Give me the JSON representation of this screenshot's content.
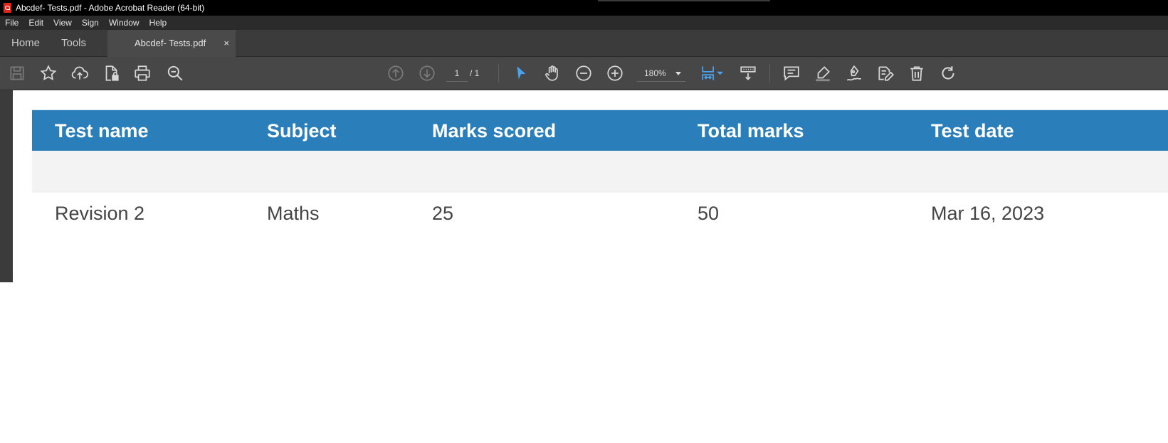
{
  "window": {
    "title": "Abcdef- Tests.pdf - Adobe Acrobat Reader (64-bit)"
  },
  "menu": [
    "File",
    "Edit",
    "View",
    "Sign",
    "Window",
    "Help"
  ],
  "tabs": {
    "home": "Home",
    "tools": "Tools",
    "document": "Abcdef- Tests.pdf",
    "close": "×"
  },
  "toolbar": {
    "page_current": "1",
    "page_total": "/ 1",
    "zoom": "180%",
    "icons": [
      "save-icon",
      "star-icon",
      "cloud-upload-icon",
      "file-lock-icon",
      "print-icon",
      "search-icon",
      "page-up-icon",
      "page-down-icon",
      "select-cursor-icon",
      "hand-icon",
      "zoom-out-icon",
      "zoom-in-icon",
      "page-fit-icon",
      "scroll-mode-icon",
      "comment-icon",
      "highlight-icon",
      "sign-icon",
      "edit-icon",
      "delete-icon",
      "rotate-icon"
    ],
    "accent": "#4aa3f0"
  },
  "table": {
    "header_color": "#2a7fbb",
    "headers": [
      "Test name",
      "Subject",
      "Marks scored",
      "Total marks",
      "Test date"
    ],
    "rows": [
      [
        "",
        "",
        "",
        "",
        ""
      ],
      [
        "Revision 2",
        "Maths",
        "25",
        "50",
        "Mar 16, 2023"
      ]
    ]
  }
}
